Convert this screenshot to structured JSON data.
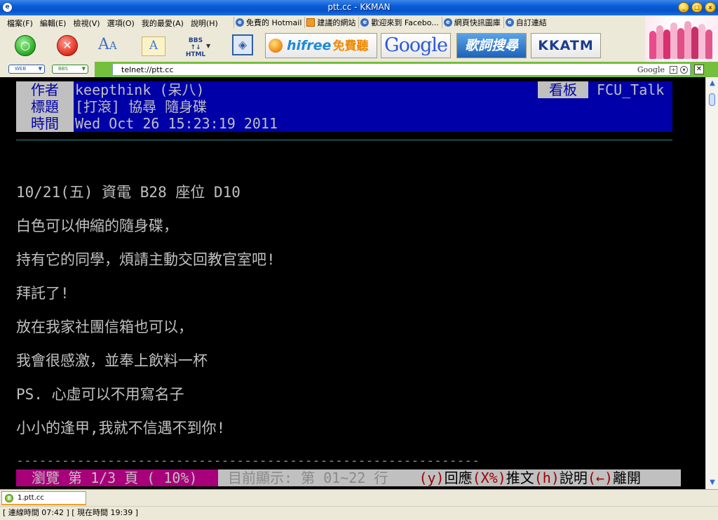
{
  "window": {
    "title": "ptt.cc - KKMAN"
  },
  "menu": [
    {
      "label": "檔案(F)"
    },
    {
      "label": "編輯(E)"
    },
    {
      "label": "檢視(V)"
    },
    {
      "label": "選項(O)"
    },
    {
      "label": "我的最愛(A)"
    },
    {
      "label": "說明(H)"
    }
  ],
  "links": [
    {
      "label": "免費的 Hotmail",
      "icon": "ie-icon"
    },
    {
      "label": "建議的網站",
      "icon": "orange-square-icon"
    },
    {
      "label": "歡迎來到 Facebo...",
      "icon": "ie-icon"
    },
    {
      "label": "網頁快訊圖庫",
      "icon": "ie-icon"
    },
    {
      "label": "自訂連結",
      "icon": "ie-icon"
    }
  ],
  "toolbar": {
    "bbs_html_label": "BBS ↑↓ HTML",
    "hifree_label": "hifree",
    "hifree_cn": "免費聽歌",
    "google_label": "Google",
    "geci_label": "歌詞搜尋",
    "kkatm_label": "KKATM"
  },
  "address": {
    "web_btn": "WEB",
    "bbs_btn": "BBS",
    "url": "telnet://ptt.cc",
    "search_engine": "Google"
  },
  "post": {
    "author_label": "作者",
    "author_value": "keepthink (呆八)",
    "title_label": "標題",
    "title_value": "[打滾] 協尋 隨身碟",
    "time_label": "時間",
    "time_value": "Wed Oct 26 15:23:19 2011",
    "board_label": "看板",
    "board_value": "FCU_Talk",
    "lines": [
      "10/21(五) 資電 B28  座位 D10",
      "白色可以伸縮的隨身碟，",
      "持有它的同學，煩請主動交回教官室吧!",
      "拜託了!",
      "放在我家社團信箱也可以，",
      "我會很感激，並奉上飲料一杯",
      "PS. 心虛可以不用寫名子",
      "小小的逢甲,我就不信遇不到你!"
    ],
    "dash_line": "-------------------------------------------------------------"
  },
  "status": {
    "browse": "瀏覽 第 1/3 頁 ( 10%)",
    "showing": "目前顯示: 第 01~22 行",
    "k_reply": "(y)",
    "t_reply": "回應",
    "k_push": "(X%)",
    "t_push": "推文",
    "k_help": "(h)",
    "t_help": "說明",
    "k_leave": "(←)",
    "t_leave": "離開"
  },
  "tabs": [
    {
      "label": "1.ptt.cc"
    }
  ],
  "statusbar": {
    "text": "[ 連線時間 07:42 ] [ 現在時間 19:39 ]"
  }
}
